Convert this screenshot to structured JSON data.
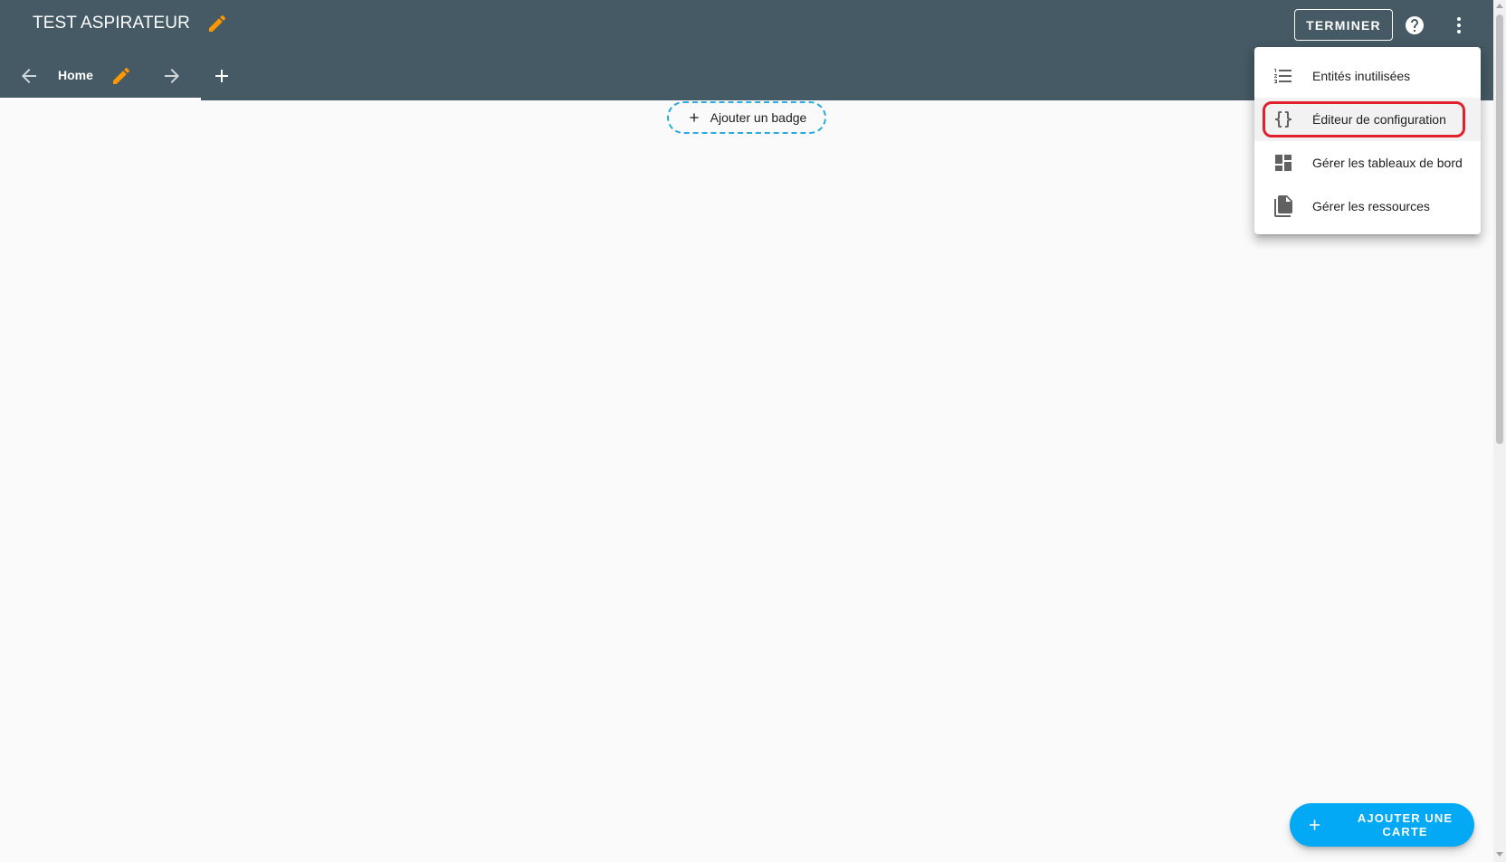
{
  "header": {
    "title": "TEST ASPIRATEUR",
    "done_label": "TERMINER",
    "icons": {
      "edit": "pencil-icon",
      "help": "help-circle-icon",
      "more": "dots-vertical-icon"
    }
  },
  "tabs": {
    "items": [
      {
        "label": "Home",
        "selected": true
      }
    ],
    "icons": {
      "prev": "arrow-left-icon",
      "next": "arrow-right-icon",
      "add": "plus-icon",
      "edit": "pencil-icon"
    }
  },
  "badge": {
    "label": "Ajouter un badge",
    "icon": "plus-icon"
  },
  "menu": {
    "items": [
      {
        "label": "Entités inutilisées",
        "icon": "format-list-numbered-icon"
      },
      {
        "label": "Éditeur de configuration",
        "icon": "code-braces-icon",
        "highlighted": true
      },
      {
        "label": "Gérer les tableaux de bord",
        "icon": "view-dashboard-icon"
      },
      {
        "label": "Gérer les ressources",
        "icon": "file-multiple-icon"
      }
    ]
  },
  "fab": {
    "label": "AJOUTER UNE CARTE",
    "icon": "plus-icon"
  },
  "colors": {
    "header_bg": "#455a64",
    "accent_orange": "#ff9800",
    "fab_blue": "#03a9f4",
    "badge_border": "#29a9e0",
    "highlight_red": "#e0202a",
    "background": "#fafafa"
  }
}
